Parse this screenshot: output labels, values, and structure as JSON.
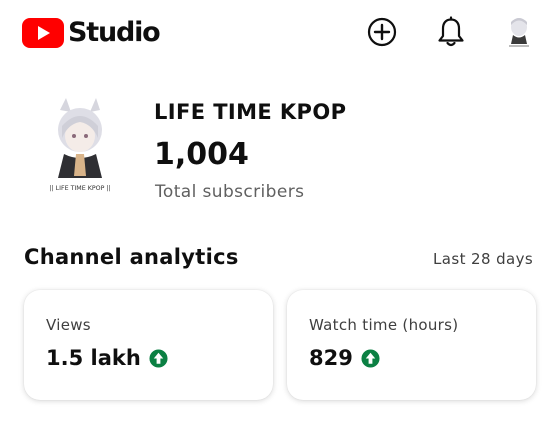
{
  "app": {
    "brand": "Studio",
    "colors": {
      "brand_red": "#ff0000",
      "trend_up_green": "#0b8043",
      "secondary_text": "#606060"
    }
  },
  "topbar": {
    "icons": [
      "youtube-logo",
      "create-icon",
      "bell-icon",
      "account-avatar"
    ]
  },
  "channel": {
    "name": "LIFE TIME KPOP",
    "avatar_caption": "|| LIFE TIME KPOP ||",
    "subscriber_count": "1,004",
    "subscriber_label": "Total subscribers"
  },
  "analytics": {
    "title": "Channel analytics",
    "period": "Last 28 days",
    "metrics": [
      {
        "label": "Views",
        "value": "1.5 lakh",
        "trend": "up"
      },
      {
        "label": "Watch time (hours)",
        "value": "829",
        "trend": "up"
      }
    ]
  }
}
